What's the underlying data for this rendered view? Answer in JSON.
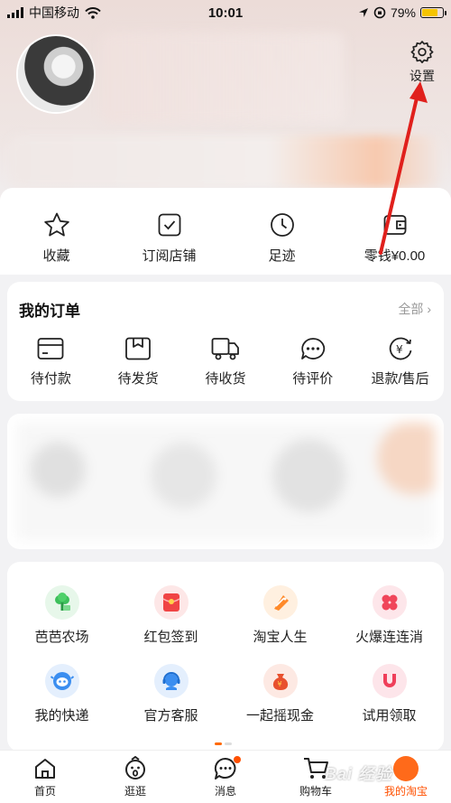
{
  "status_bar": {
    "carrier": "中国移动",
    "time": "10:01",
    "battery_percent": "79%",
    "battery_level": 0.79
  },
  "header": {
    "settings_label": "设置"
  },
  "quick_links": [
    {
      "label": "收藏",
      "icon": "star-icon"
    },
    {
      "label": "订阅店铺",
      "icon": "check-box-icon"
    },
    {
      "label": "足迹",
      "icon": "clock-icon"
    },
    {
      "label": "零钱¥0.00",
      "icon": "wallet-icon"
    }
  ],
  "orders": {
    "title": "我的订单",
    "all_label": "全部",
    "items": [
      {
        "label": "待付款",
        "icon": "card-icon"
      },
      {
        "label": "待发货",
        "icon": "box-icon"
      },
      {
        "label": "待收货",
        "icon": "truck-icon"
      },
      {
        "label": "待评价",
        "icon": "comment-icon"
      },
      {
        "label": "退款/售后",
        "icon": "refund-icon"
      }
    ]
  },
  "apps": [
    {
      "label": "芭芭农场",
      "icon": "farm-icon",
      "color": "#3cbf5a",
      "bg": "#e7f7ea"
    },
    {
      "label": "红包签到",
      "icon": "red-envelope-icon",
      "color": "#f04444",
      "bg": "#fde7e7"
    },
    {
      "label": "淘宝人生",
      "icon": "taobao-life-icon",
      "color": "#ff8a2a",
      "bg": "#fff0e0"
    },
    {
      "label": "火爆连连消",
      "icon": "match-game-icon",
      "color": "#f0465a",
      "bg": "#fde6ea"
    },
    {
      "label": "我的快递",
      "icon": "delivery-icon",
      "color": "#3b8ef0",
      "bg": "#e4effd"
    },
    {
      "label": "官方客服",
      "icon": "customer-service-icon",
      "color": "#3b8ef0",
      "bg": "#e4effd"
    },
    {
      "label": "一起摇现金",
      "icon": "money-bag-icon",
      "color": "#e8502e",
      "bg": "#fde9e3"
    },
    {
      "label": "试用领取",
      "icon": "magnet-icon",
      "color": "#ef3f5a",
      "bg": "#fde5ea"
    }
  ],
  "tabbar": [
    {
      "label": "首页",
      "icon": "home-icon"
    },
    {
      "label": "逛逛",
      "icon": "browse-icon"
    },
    {
      "label": "消息",
      "icon": "message-icon"
    },
    {
      "label": "购物车",
      "icon": "cart-icon"
    },
    {
      "label": "我的淘宝",
      "icon": "avatar-icon"
    }
  ],
  "colors": {
    "accent": "#ff5000",
    "annotation_arrow": "#e0201c"
  },
  "watermark": "Bai 经验"
}
